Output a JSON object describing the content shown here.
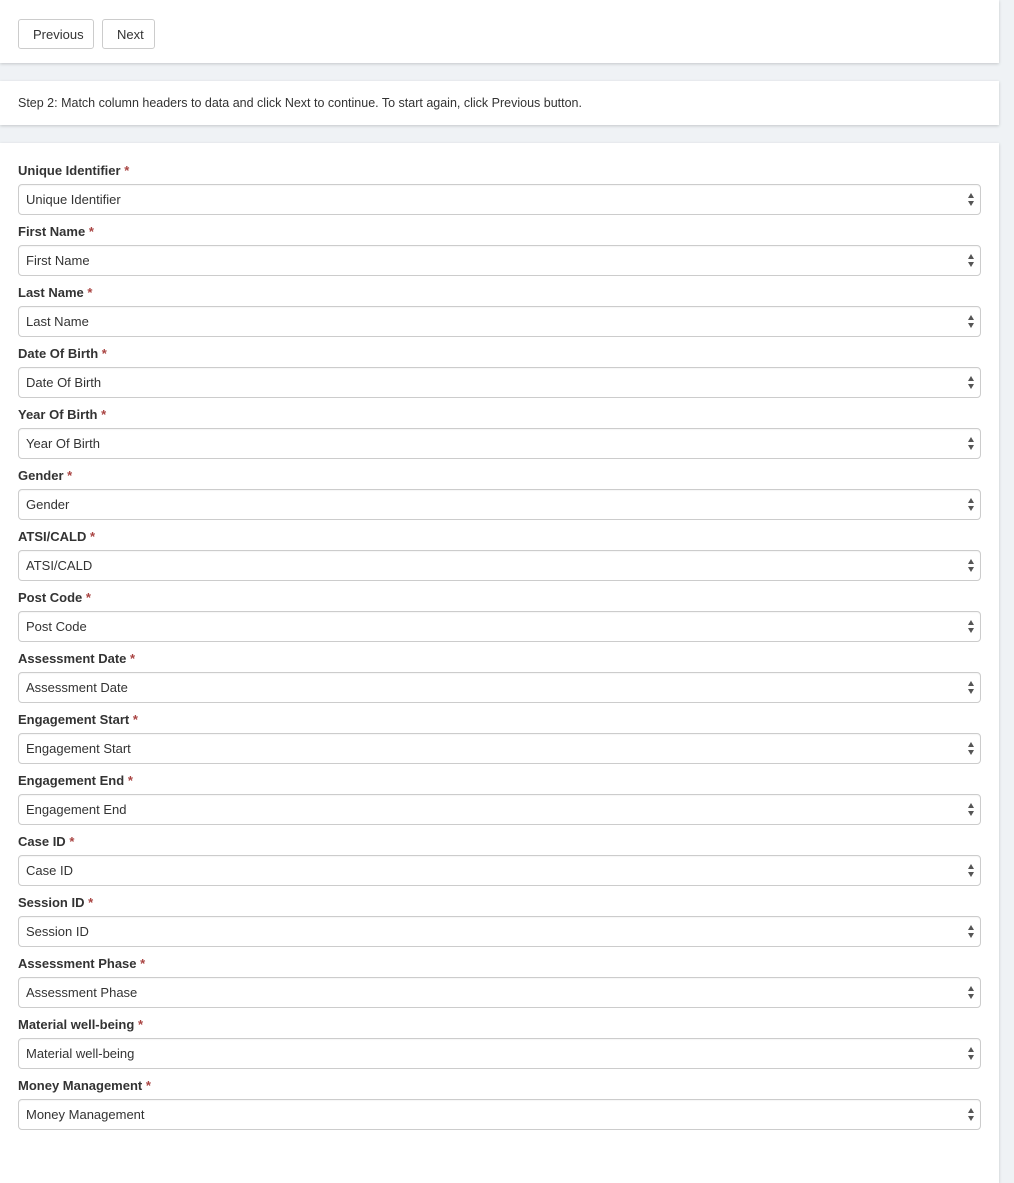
{
  "nav": {
    "previous_label": "Previous",
    "next_label": "Next"
  },
  "step": {
    "text": "Step 2: Match column headers to data and click Next to continue. To start again, click Previous button."
  },
  "required_marker": "*",
  "fields": [
    {
      "label": "Unique Identifier",
      "value": "Unique Identifier"
    },
    {
      "label": "First Name",
      "value": "First Name"
    },
    {
      "label": "Last Name",
      "value": "Last Name"
    },
    {
      "label": "Date Of Birth",
      "value": "Date Of Birth"
    },
    {
      "label": "Year Of Birth",
      "value": "Year Of Birth"
    },
    {
      "label": "Gender",
      "value": "Gender"
    },
    {
      "label": "ATSI/CALD",
      "value": "ATSI/CALD"
    },
    {
      "label": "Post Code",
      "value": "Post Code"
    },
    {
      "label": "Assessment Date",
      "value": "Assessment Date"
    },
    {
      "label": "Engagement Start",
      "value": "Engagement Start"
    },
    {
      "label": "Engagement End",
      "value": "Engagement End"
    },
    {
      "label": "Case ID",
      "value": "Case ID"
    },
    {
      "label": "Session ID",
      "value": "Session ID"
    },
    {
      "label": "Assessment Phase",
      "value": "Assessment Phase"
    },
    {
      "label": "Material well-being",
      "value": "Material well-being"
    },
    {
      "label": "Money Management",
      "value": "Money Management"
    }
  ]
}
